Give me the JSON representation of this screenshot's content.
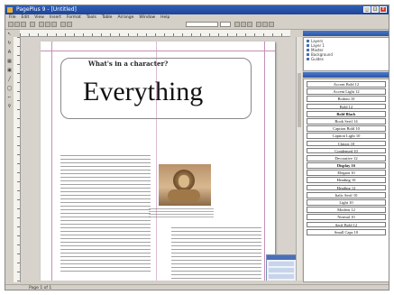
{
  "window": {
    "title": "PagePlus 9 - [Untitled]"
  },
  "menu": [
    "File",
    "Edit",
    "View",
    "Insert",
    "Format",
    "Tools",
    "Table",
    "Arrange",
    "Window",
    "Help"
  ],
  "document": {
    "kicker": "What's in a character?",
    "headline": "Everything"
  },
  "layers": [
    "Layers",
    "Layer 1",
    "Master",
    "Background",
    "Guides"
  ],
  "styles": [
    "Accent Bold 12",
    "Accent Light 12",
    "Bodoni 10",
    "Bold 12",
    "Bold Black",
    "Book Serif 14",
    "Caption Bold 10",
    "Caption Light 10",
    "Classic 10",
    "Condensed 10",
    "Decorative 12",
    "Display 16",
    "Elegant 10",
    "Heading 10",
    "Heading 12",
    "Italic Serif 10",
    "Light 10",
    "Modern 12",
    "Normal 10",
    "Serif Bold 12",
    "Small Caps 10"
  ],
  "bold_styles": [
    4,
    11
  ],
  "status": "Page 1 of 1"
}
